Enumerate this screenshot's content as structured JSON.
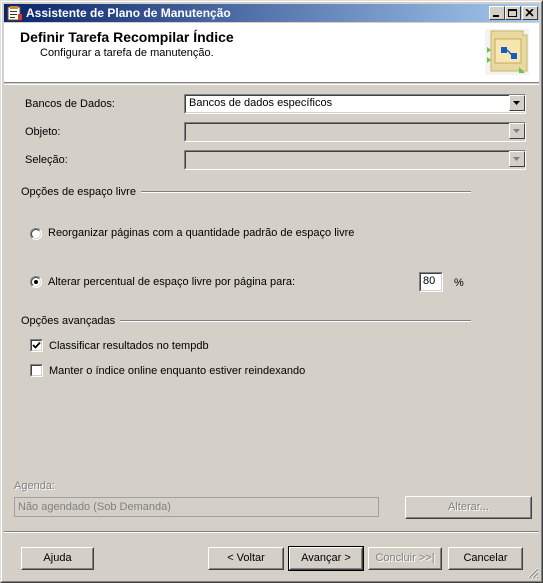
{
  "window": {
    "title": "Assistente de Plano de Manutenção"
  },
  "header": {
    "title": "Definir Tarefa Recompilar Índice",
    "subtitle": "Configurar a tarefa de manutenção."
  },
  "form": {
    "databases_label": "Bancos de Dados:",
    "databases_value": "Bancos de dados específicos",
    "object_label": "Objeto:",
    "object_value": "",
    "selection_label": "Seleção:",
    "selection_value": ""
  },
  "free_space": {
    "group_label": "Opções de espaço livre",
    "option_reorganize": "Reorganizar páginas com a quantidade padrão de espaço livre",
    "option_change": "Alterar percentual de espaço livre por página para:",
    "selected_option": "change",
    "percent_value": "80",
    "percent_unit": "%"
  },
  "advanced": {
    "group_label": "Opções avançadas",
    "sort_tempdb_label": "Classificar resultados no tempdb",
    "sort_tempdb_checked": true,
    "keep_online_label": "Manter o índice online enquanto estiver reindexando",
    "keep_online_checked": false
  },
  "schedule": {
    "label": "Agenda:",
    "value": "Não agendado (Sob Demanda)",
    "change_button": "Alterar..."
  },
  "buttons": {
    "help": "Ajuda",
    "back": "< Voltar",
    "next": "Avançar >",
    "finish": "Concluir >>|",
    "cancel": "Cancelar"
  }
}
